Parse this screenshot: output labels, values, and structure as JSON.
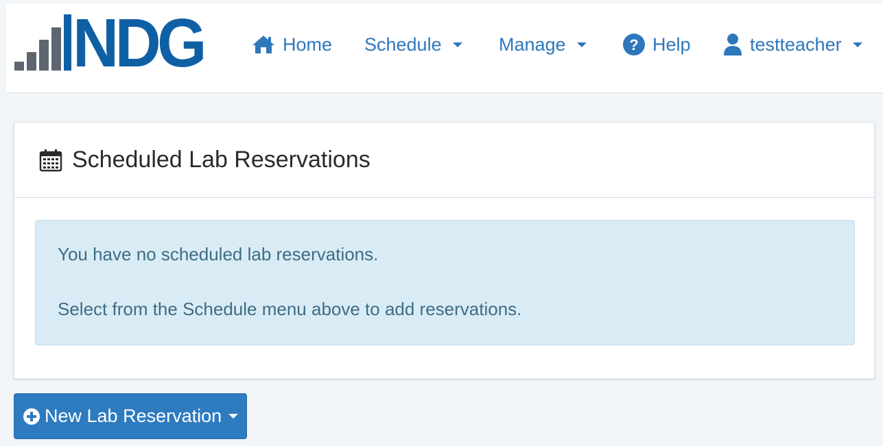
{
  "brand": {
    "logo_text": "NDG"
  },
  "nav": {
    "home": {
      "label": "Home",
      "icon": "home-icon"
    },
    "schedule": {
      "label": "Schedule",
      "icon": "chevron-down-icon"
    },
    "manage": {
      "label": "Manage",
      "icon": "chevron-down-icon"
    },
    "help": {
      "label": "Help",
      "icon": "question-circle-icon"
    },
    "user": {
      "label": "testteacher",
      "icon": "user-icon"
    }
  },
  "panel": {
    "title": "Scheduled Lab Reservations",
    "icon": "calendar-icon",
    "alert_line1": "You have no scheduled lab reservations.",
    "alert_line2": "Select from the Schedule menu above to add reservations."
  },
  "actions": {
    "new_reservation_label": "New Lab Reservation",
    "new_reservation_icon": "plus-circle-icon"
  },
  "colors": {
    "brand": "#0f5fa5",
    "link": "#2f77bb",
    "alert_bg": "#d9ecf6",
    "button": "#2e7bbf",
    "page_bg": "#f2f6f9"
  }
}
